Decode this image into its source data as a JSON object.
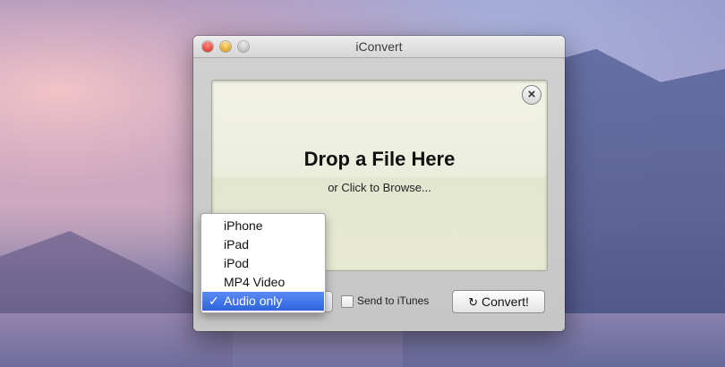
{
  "window": {
    "title": "iConvert"
  },
  "dropzone": {
    "title": "Drop a File Here",
    "subtitle": "or Click to Browse...",
    "close_icon": "circle-x-icon"
  },
  "format_menu": {
    "options": [
      "iPhone",
      "iPad",
      "iPod",
      "MP4 Video",
      "Audio only"
    ],
    "selected": "Audio only",
    "check_mark": "✓"
  },
  "send_to_itunes": {
    "label": "Send to iTunes",
    "checked": false
  },
  "convert_button": {
    "label": "Convert!",
    "icon": "refresh-icon"
  },
  "traffic_lights": {
    "close": "#e0443a",
    "minimize": "#e0a52a",
    "zoom": "#bdbdbd"
  }
}
